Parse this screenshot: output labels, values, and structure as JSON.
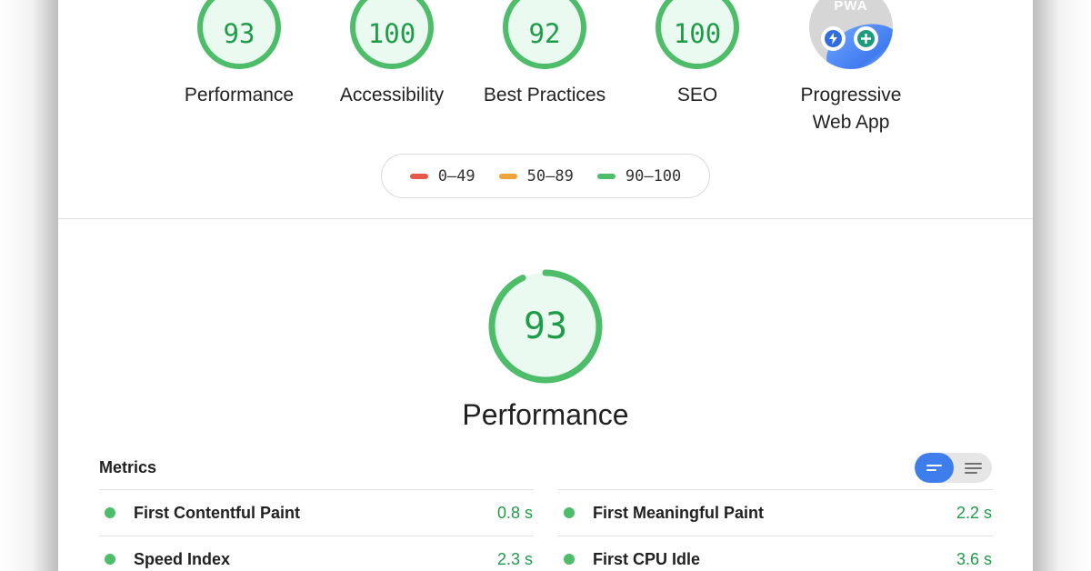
{
  "colors": {
    "pass": "#4dbd6a",
    "pass_text": "#1f9c48",
    "pass_fill": "#eafaf0",
    "average": "#f0a33a",
    "fail": "#e8574a",
    "toggle_active": "#3d7eec"
  },
  "categories": [
    {
      "score": "93",
      "label": "Performance"
    },
    {
      "score": "100",
      "label": "Accessibility"
    },
    {
      "score": "92",
      "label": "Best Practices"
    },
    {
      "score": "100",
      "label": "SEO"
    }
  ],
  "pwa": {
    "badge_text": "PWA",
    "label_line1": "Progressive",
    "label_line2": "Web App",
    "badges": [
      "lightning-icon",
      "plus-icon"
    ]
  },
  "legend": [
    {
      "range": "0–49",
      "color": "#e8574a"
    },
    {
      "range": "50–89",
      "color": "#f0a33a"
    },
    {
      "range": "90–100",
      "color": "#4dbd6a"
    }
  ],
  "performance": {
    "score": "93",
    "score_fraction": 0.93,
    "title": "Performance"
  },
  "metrics": {
    "title": "Metrics",
    "view_toggle": {
      "selected": "compact-view-icon",
      "other": "expanded-view-icon"
    },
    "left": [
      {
        "name": "First Contentful Paint",
        "value": "0.8 s"
      },
      {
        "name": "Speed Index",
        "value": "2.3 s"
      }
    ],
    "right": [
      {
        "name": "First Meaningful Paint",
        "value": "2.2 s"
      },
      {
        "name": "First CPU Idle",
        "value": "3.6 s"
      }
    ]
  }
}
